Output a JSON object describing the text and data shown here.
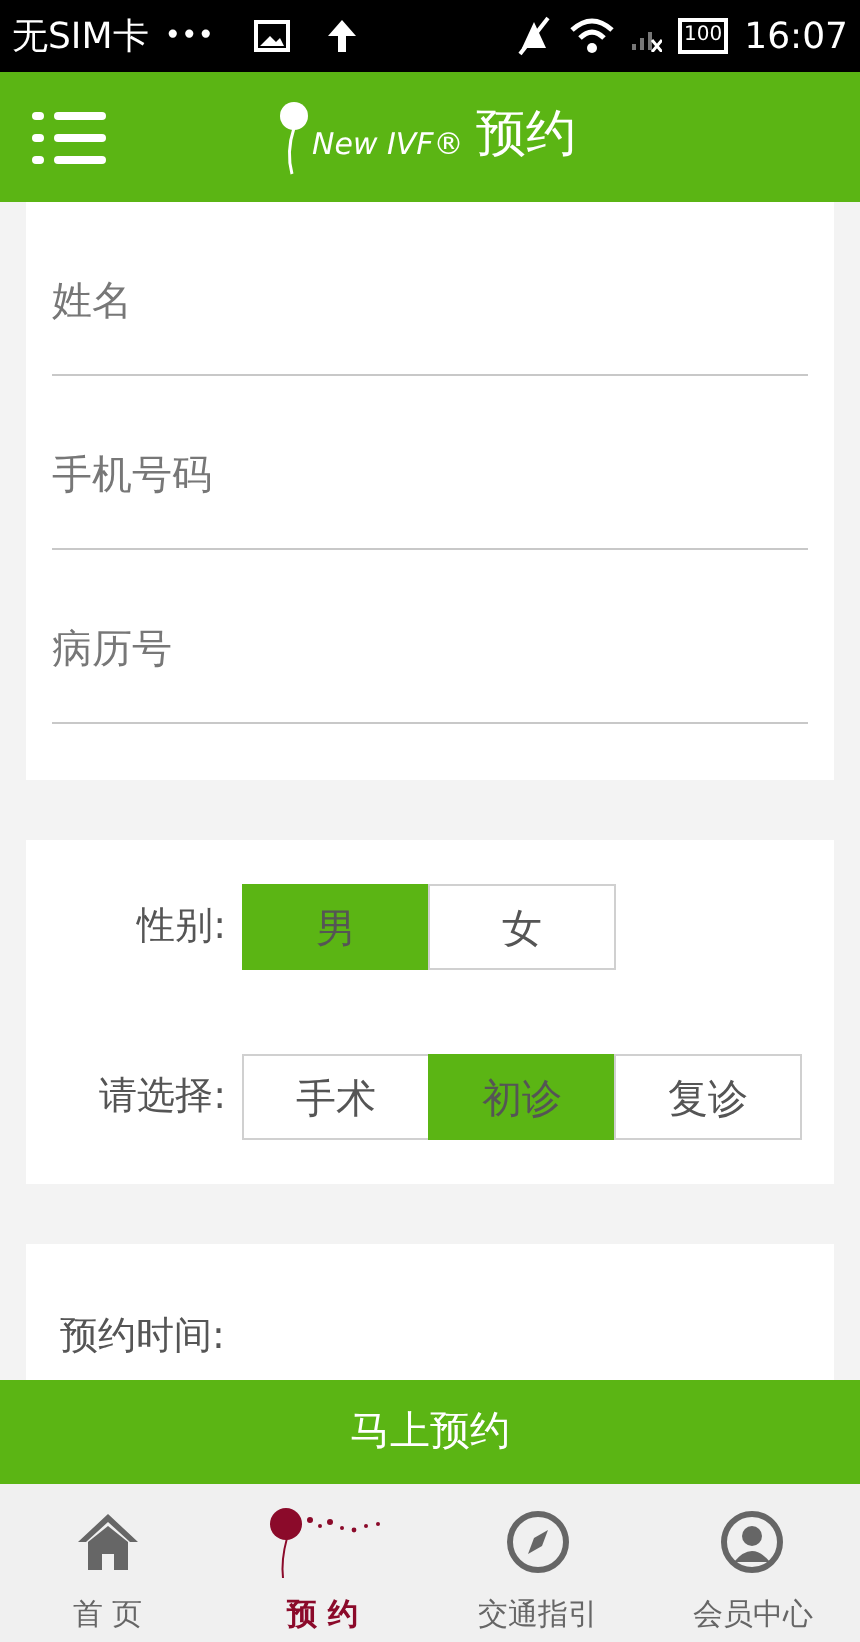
{
  "status_bar": {
    "carrier": "无SIM卡",
    "more": "•••",
    "battery": "100",
    "time": "16:07"
  },
  "header": {
    "logo_text": "New IVF®",
    "title": "预约"
  },
  "fields": [
    {
      "placeholder": "姓名"
    },
    {
      "placeholder": "手机号码"
    },
    {
      "placeholder": "病历号"
    }
  ],
  "choices": [
    {
      "label": "性别:",
      "options": [
        {
          "label": "男",
          "selected": true
        },
        {
          "label": "女",
          "selected": false
        }
      ]
    },
    {
      "label": "请选择:",
      "options": [
        {
          "label": "手术",
          "selected": false
        },
        {
          "label": "初诊",
          "selected": true
        },
        {
          "label": "复诊",
          "selected": false
        }
      ]
    }
  ],
  "time_label": "预约时间:",
  "submit": "马上预约",
  "tabs": [
    {
      "kind": "home",
      "label": "首 页",
      "selected": false
    },
    {
      "kind": "dandelion",
      "label": "预 约",
      "selected": true
    },
    {
      "kind": "compass",
      "label": "交通指引",
      "selected": false
    },
    {
      "kind": "user",
      "label": "会员中心",
      "selected": false
    }
  ]
}
